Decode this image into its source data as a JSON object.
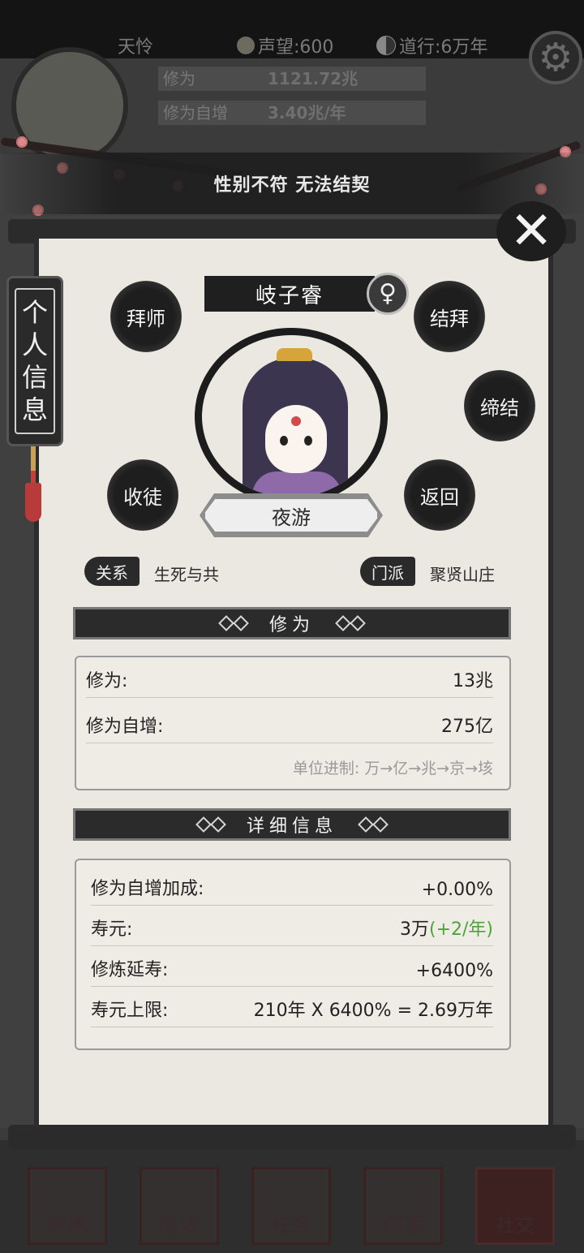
{
  "top_bar": {
    "player_name": "天怜",
    "reputation": "声望:600",
    "daoxing": "道行:6万年"
  },
  "player_stats": {
    "cultivation_label": "修为",
    "cultivation_value": "1121.72兆",
    "growth_label": "修为自增",
    "growth_value": "3.40兆/年"
  },
  "toast": {
    "message": "性别不符 无法结契"
  },
  "side_tab": {
    "chars": [
      "个",
      "人",
      "信",
      "息"
    ]
  },
  "character": {
    "name": "岐子睿",
    "gender_symbol": "♀",
    "title": "夜游"
  },
  "actions": {
    "apprentice": "拜师",
    "sworn": "结拜",
    "bond": "缔结",
    "take_disciple": "收徒",
    "back": "返回"
  },
  "relation": {
    "label": "关系",
    "value": "生死与共"
  },
  "sect": {
    "label": "门派",
    "value": "聚贤山庄"
  },
  "cultivation_section": {
    "header": "修为",
    "rows": [
      {
        "key": "修为:",
        "value": "13兆"
      },
      {
        "key": "修为自增:",
        "value": "275亿"
      }
    ],
    "unit_note": "单位进制: 万→亿→兆→京→垓"
  },
  "detail_section": {
    "header": "详细信息",
    "rows": [
      {
        "key": "修为自增加成:",
        "value": "+0.00%"
      },
      {
        "key": "寿元:",
        "value": "3万",
        "extra": "(+2/年)"
      },
      {
        "key": "修炼延寿:",
        "value": "+6400%"
      },
      {
        "key": "寿元上限:",
        "value": "210年 X 6400% = 2.69万年"
      }
    ]
  },
  "bottom_nav": [
    {
      "label": "修炼"
    },
    {
      "label": "心法"
    },
    {
      "label": "任务"
    },
    {
      "label": "门派"
    },
    {
      "label": "社交"
    }
  ],
  "colors": {
    "accent_green": "#4ea33a",
    "panel_bg": "#ebe8e2",
    "ink": "#1e1e1e"
  }
}
